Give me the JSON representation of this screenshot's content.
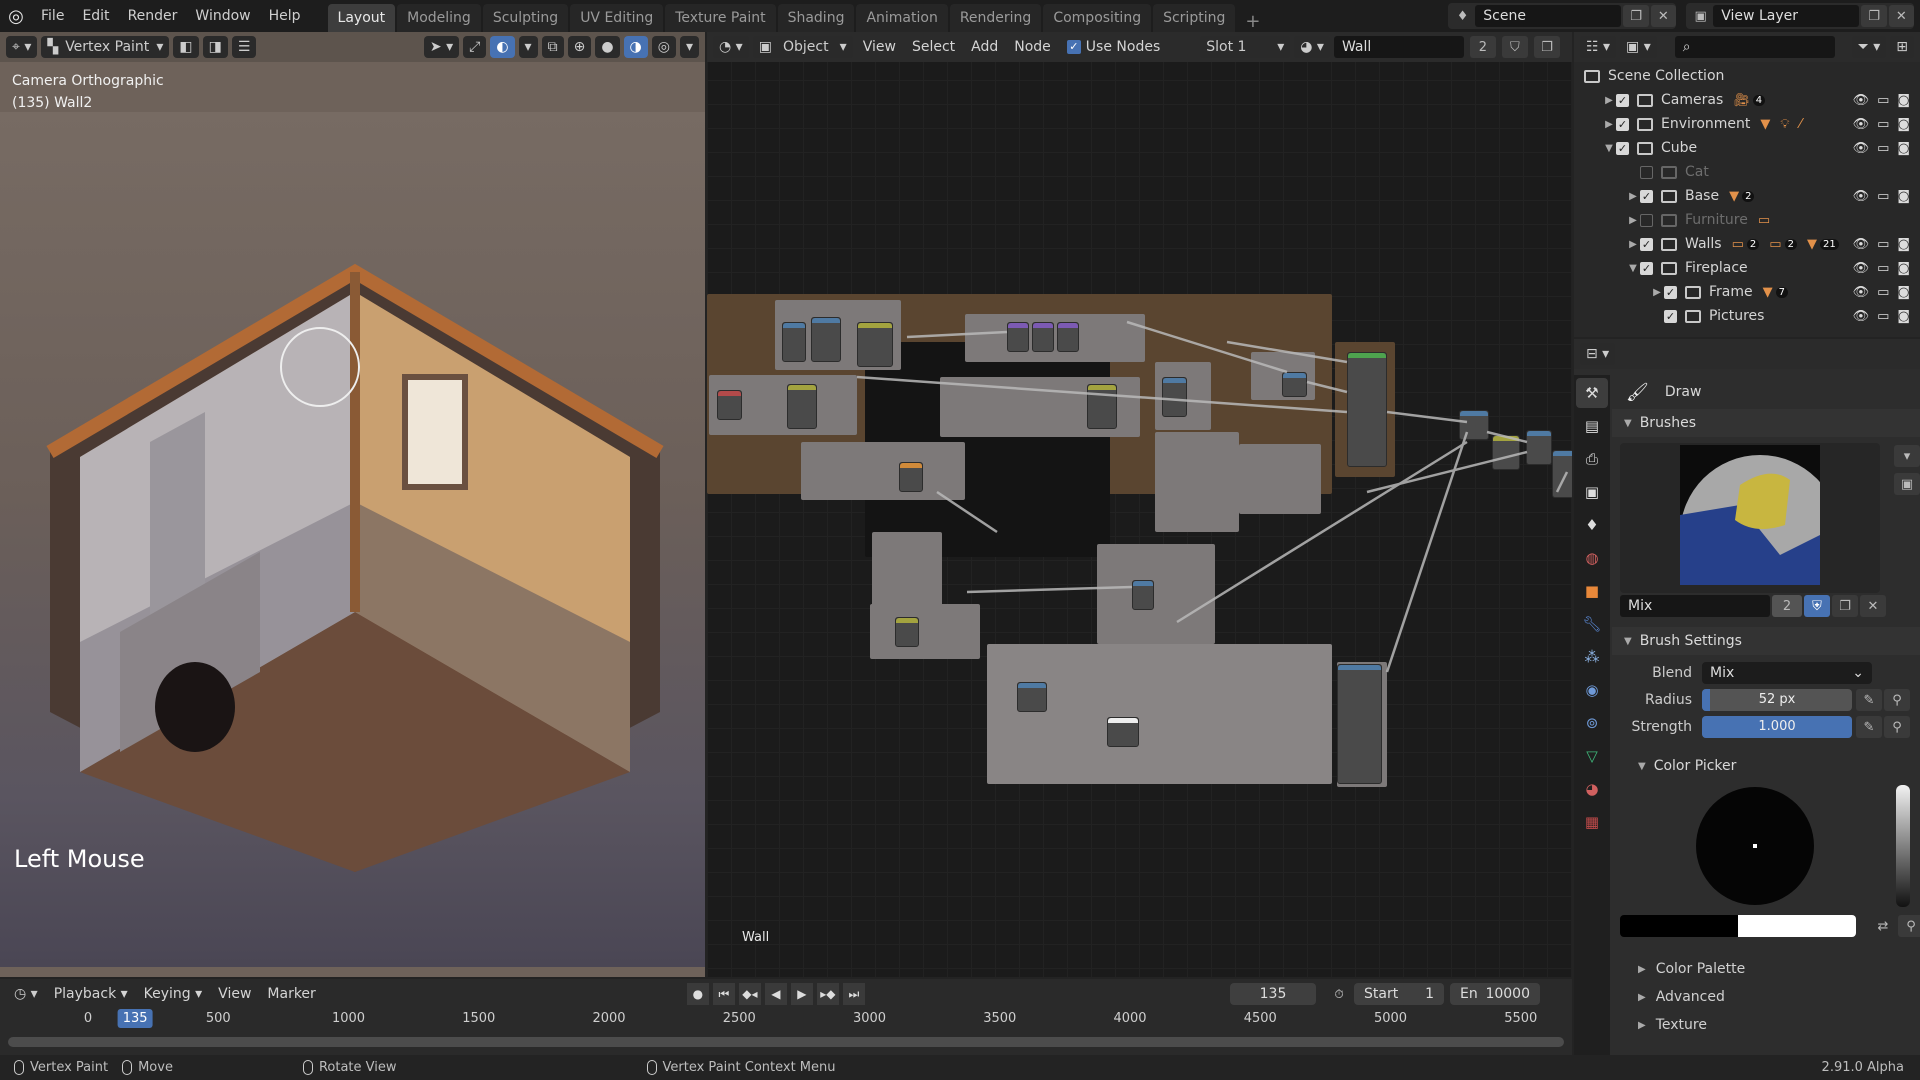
{
  "topbar": {
    "menus": [
      "File",
      "Edit",
      "Render",
      "Window",
      "Help"
    ],
    "workspaces": [
      "Layout",
      "Modeling",
      "Sculpting",
      "UV Editing",
      "Texture Paint",
      "Shading",
      "Animation",
      "Rendering",
      "Compositing",
      "Scripting"
    ],
    "active_workspace": "Layout",
    "add_workspace": "+",
    "scene": "Scene",
    "view_layer": "View Layer"
  },
  "viewport": {
    "mode": "Vertex Paint",
    "overlay_title": "Camera Orthographic",
    "overlay_object": "(135) Wall2",
    "last_input": "Left Mouse"
  },
  "node_editor": {
    "object_type": "Object",
    "menus": [
      "View",
      "Select",
      "Add",
      "Node"
    ],
    "use_nodes_label": "Use Nodes",
    "use_nodes": true,
    "slot": "Slot 1",
    "material": "Wall",
    "material_users": "2",
    "footer_label": "Wall"
  },
  "outliner": {
    "root": "Scene Collection",
    "items": [
      {
        "name": "Cameras",
        "depth": 0,
        "expand": "collapsed",
        "checked": true,
        "badges": [
          {
            "icon": "camera",
            "count": "4"
          }
        ],
        "visible": true
      },
      {
        "name": "Environment",
        "depth": 0,
        "expand": "collapsed",
        "checked": true,
        "badges": [
          {
            "icon": "mesh"
          },
          {
            "icon": "light"
          },
          {
            "icon": "empty"
          }
        ],
        "visible": true
      },
      {
        "name": "Cube",
        "depth": 0,
        "expand": "expanded",
        "checked": true,
        "badges": [],
        "visible": true
      },
      {
        "name": "Cat",
        "depth": 1,
        "expand": "none",
        "checked": false,
        "badges": [],
        "visible": false
      },
      {
        "name": "Base",
        "depth": 1,
        "expand": "collapsed",
        "checked": true,
        "badges": [
          {
            "icon": "mesh",
            "count": "2"
          }
        ],
        "visible": true
      },
      {
        "name": "Furniture",
        "depth": 1,
        "expand": "collapsed",
        "checked": false,
        "badges": [
          {
            "icon": "collection"
          }
        ],
        "visible": false
      },
      {
        "name": "Walls",
        "depth": 1,
        "expand": "collapsed",
        "checked": true,
        "badges": [
          {
            "icon": "collection",
            "count": "2"
          },
          {
            "icon": "collection",
            "count": "2"
          },
          {
            "icon": "mesh",
            "count": "21"
          }
        ],
        "visible": true
      },
      {
        "name": "Fireplace",
        "depth": 1,
        "expand": "expanded",
        "checked": true,
        "badges": [],
        "visible": true
      },
      {
        "name": "Frame",
        "depth": 2,
        "expand": "collapsed",
        "checked": true,
        "badges": [
          {
            "icon": "mesh",
            "count": "7"
          }
        ],
        "visible": true
      },
      {
        "name": "Pictures",
        "depth": 2,
        "expand": "none",
        "checked": true,
        "badges": [],
        "visible": true
      }
    ]
  },
  "properties": {
    "tool": "Draw",
    "brushes_panel": "Brushes",
    "brush_name": "Mix",
    "brush_users": "2",
    "brush_settings_panel": "Brush Settings",
    "blend_label": "Blend",
    "blend_value": "Mix",
    "radius_label": "Radius",
    "radius_value": "52 px",
    "radius_fraction": 0.05,
    "strength_label": "Strength",
    "strength_value": "1.000",
    "strength_fraction": 1.0,
    "color_picker_panel": "Color Picker",
    "primary_color": "#000000",
    "secondary_color": "#ffffff",
    "subpanels": [
      "Color Palette",
      "Advanced",
      "Texture"
    ]
  },
  "timeline": {
    "menus": [
      "Playback",
      "Keying",
      "View",
      "Marker"
    ],
    "current_frame": "135",
    "start_label": "Start",
    "start": "1",
    "end_label": "En",
    "end": "10000",
    "ticks": [
      "0",
      "500",
      "1000",
      "1500",
      "2000",
      "2500",
      "3000",
      "3500",
      "4000",
      "4500",
      "5000",
      "5500"
    ]
  },
  "statusbar": {
    "items": [
      "Vertex Paint",
      "Move",
      "Rotate View",
      "Vertex Paint Context Menu"
    ],
    "version": "2.91.0 Alpha"
  },
  "colors": {
    "accent": "#4772b3",
    "frame_brown": "#5a4530",
    "node_gray": "#8a8685"
  }
}
